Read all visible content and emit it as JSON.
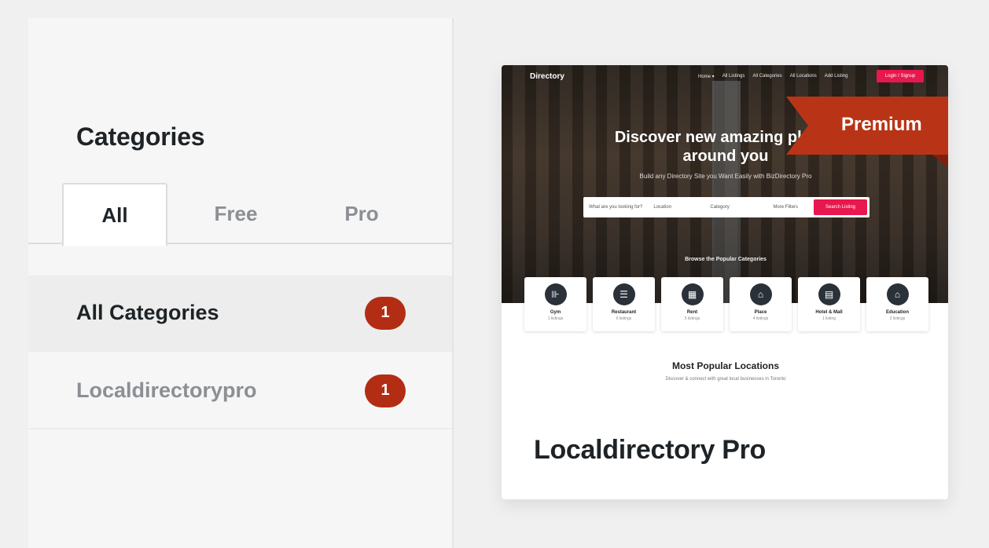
{
  "sidebar": {
    "title": "Categories",
    "tabs": [
      {
        "label": "All",
        "active": true
      },
      {
        "label": "Free",
        "active": false
      },
      {
        "label": "Pro",
        "active": false
      }
    ],
    "categories": [
      {
        "label": "All Categories",
        "count": "1",
        "selected": true
      },
      {
        "label": "Localdirectorypro",
        "count": "1",
        "selected": false
      }
    ]
  },
  "card": {
    "ribbon": "Premium",
    "title": "Localdirectory Pro",
    "preview": {
      "logo": "Directory",
      "nav": [
        "Home ▾",
        "All Listings",
        "All Categories",
        "All Locations",
        "Add Listing"
      ],
      "login": "Login / Signup",
      "headline": "Discover new amazing places around you",
      "subheadline": "Build any Directory Site you Want Easily with BizDirectory Pro",
      "search": {
        "what": "What are you looking for?",
        "location": "Location",
        "category": "Category",
        "filters": "More Filters",
        "button": "Search Listing"
      },
      "browse_title": "Browse the Popular Categories",
      "categories": [
        {
          "name": "Gym",
          "count": "1 listings",
          "icon": "dumbbell-icon"
        },
        {
          "name": "Restaurant",
          "count": "6 listings",
          "icon": "burger-icon"
        },
        {
          "name": "Rent",
          "count": "5 listings",
          "icon": "building-icon"
        },
        {
          "name": "Place",
          "count": "4 listings",
          "icon": "place-icon"
        },
        {
          "name": "Hotel & Mall",
          "count": "1 listing",
          "icon": "hotel-icon"
        },
        {
          "name": "Education",
          "count": "2 listings",
          "icon": "school-icon"
        }
      ],
      "popular_title": "Most Popular Locations",
      "popular_sub": "Discover & connect with great local businesses in Toronto"
    }
  },
  "colors": {
    "accent": "#b32d14",
    "ribbon": "#b93416",
    "preview_button": "#e8174d"
  }
}
